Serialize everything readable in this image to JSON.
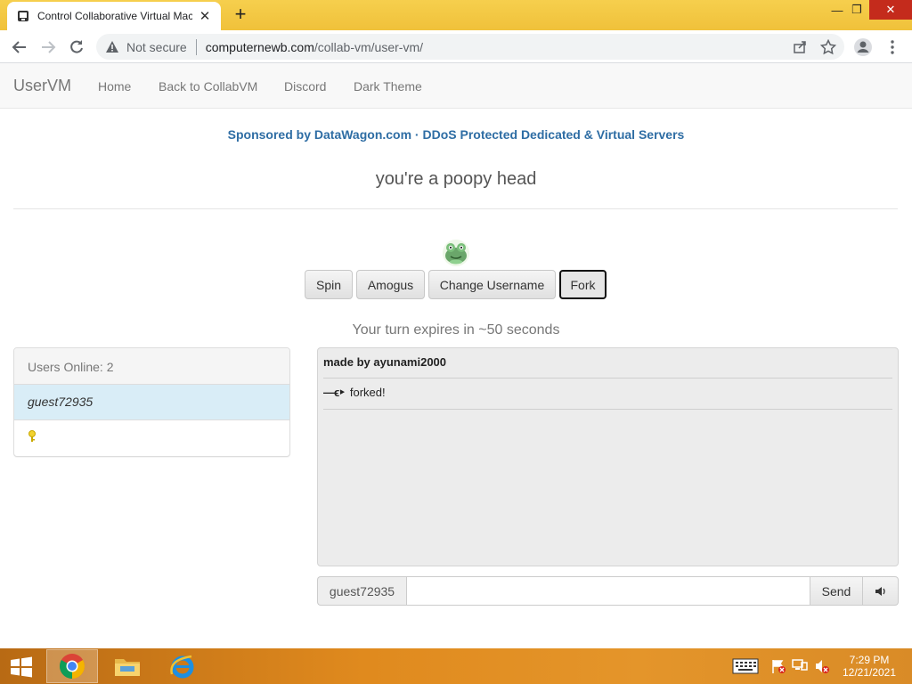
{
  "browser": {
    "tab_title": "Control Collaborative Virtual Mac",
    "url_security": "Not secure",
    "url_domain": "computernewb.com",
    "url_path": "/collab-vm/user-vm/"
  },
  "navbar": {
    "brand": "UserVM",
    "links": [
      "Home",
      "Back to CollabVM",
      "Discord",
      "Dark Theme"
    ]
  },
  "sponsor_text": "Sponsored by DataWagon.com · DDoS Protected Dedicated & Virtual Servers",
  "motd": "you're a poopy head",
  "buttons": {
    "spin": "Spin",
    "amogus": "Amogus",
    "change_username": "Change Username",
    "fork": "Fork"
  },
  "turn_text": "Your turn expires in ~50 seconds",
  "users": {
    "header": "Users Online: 2",
    "list": [
      "guest72935"
    ]
  },
  "chat": {
    "messages": [
      {
        "text": "made by ayunami2000"
      },
      {
        "prefix": "—ϵ‣",
        "text": "forked!"
      }
    ],
    "username": "guest72935",
    "input_value": "",
    "send_label": "Send"
  },
  "taskbar": {
    "time": "7:29 PM",
    "date": "12/21/2021"
  },
  "colors": {
    "sponsor": "#2e6da4",
    "selected_user": "#d9edf7",
    "taskbar": "#e08a1e"
  }
}
